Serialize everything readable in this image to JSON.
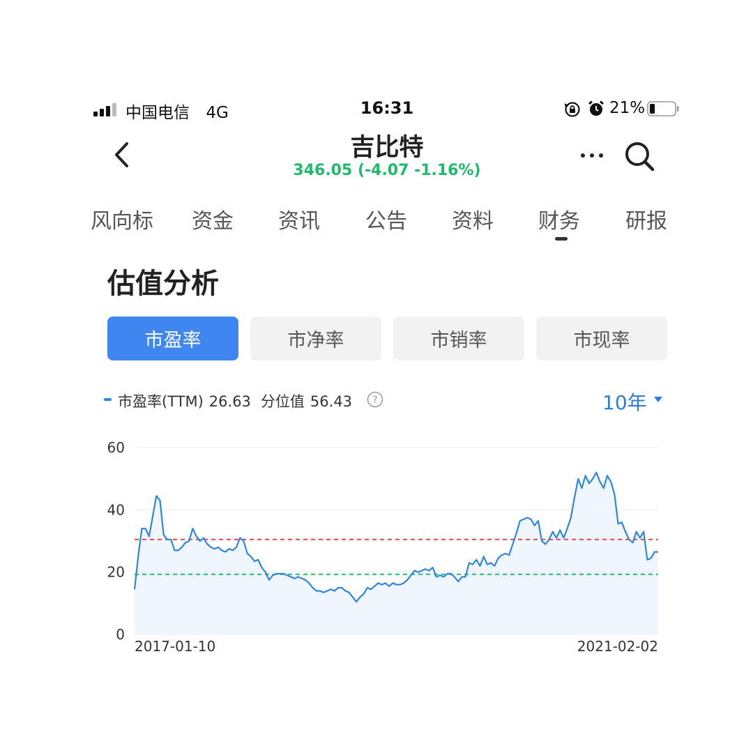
{
  "status_bar": {
    "carrier": "中国电信",
    "network": "4G",
    "time": "16:31",
    "battery_percent": "21%",
    "battery_level": 0.21
  },
  "header": {
    "title": "吉比特",
    "price_line": "346.05 (-4.07 -1.16%)",
    "price_color": "#1dbb6b"
  },
  "tabs": [
    {
      "label": "风向标"
    },
    {
      "label": "资金"
    },
    {
      "label": "资讯"
    },
    {
      "label": "公告"
    },
    {
      "label": "资料"
    },
    {
      "label": "财务",
      "active": true
    },
    {
      "label": "研报"
    }
  ],
  "section": {
    "title": "估值分析"
  },
  "segments": [
    {
      "label": "市盈率",
      "active": true
    },
    {
      "label": "市净率",
      "active": false
    },
    {
      "label": "市销率",
      "active": false
    },
    {
      "label": "市现率",
      "active": false
    }
  ],
  "legend": {
    "series_label": "市盈率(TTM)",
    "series_value": "26.63",
    "percentile_label": "分位值",
    "percentile_value": "56.43",
    "help_glyph": "?"
  },
  "period": {
    "label": "10年"
  },
  "colors": {
    "accent": "#3f86f0",
    "line": "#2e86e0",
    "upper_ref": "#e8434c",
    "lower_ref": "#1dbb6b"
  },
  "chart_data": {
    "type": "area",
    "x_start_label": "2017-01-10",
    "x_end_label": "2021-02-02",
    "ylim": [
      0,
      60
    ],
    "y_ticks": [
      "60",
      "40",
      "20",
      "0"
    ],
    "grid": true,
    "reference_lines": [
      {
        "value": 30.5,
        "color": "#e8434c",
        "style": "dashed"
      },
      {
        "value": 19.3,
        "color": "#1dbb6b",
        "style": "dashed"
      }
    ],
    "values": [
      14.5,
      25,
      34,
      34,
      31.5,
      38,
      44.5,
      43,
      32,
      30.5,
      30.5,
      27,
      27,
      28,
      29.5,
      30,
      34,
      31.5,
      30,
      31,
      29,
      28,
      27.5,
      28,
      27,
      26.5,
      27.5,
      27,
      28,
      31,
      30,
      26,
      25,
      23.5,
      24,
      21.5,
      20,
      17.5,
      19,
      19.5,
      19.5,
      19.5,
      19,
      18.5,
      18,
      18.5,
      18,
      17.5,
      16.5,
      15,
      14,
      14,
      13.5,
      14,
      14.5,
      14,
      15,
      15,
      14,
      13.5,
      12,
      10.5,
      12,
      13,
      15,
      14.5,
      15.5,
      16.5,
      16,
      16.5,
      15.5,
      16.5,
      16,
      16,
      16.5,
      17.5,
      19,
      20.5,
      20,
      20.5,
      21,
      20.5,
      21.5,
      18.5,
      19,
      18.5,
      19.5,
      19.5,
      18.5,
      17,
      18.5,
      18.5,
      23,
      22.5,
      24,
      22,
      25,
      22.5,
      23,
      22,
      24.5,
      25.5,
      26,
      25.5,
      29,
      32.5,
      36.5,
      37,
      37.5,
      37,
      35,
      36.5,
      30,
      29,
      30.5,
      33,
      31,
      33.5,
      31,
      34,
      37.5,
      44,
      50,
      47,
      51,
      48.5,
      50,
      52,
      49,
      47,
      51,
      49,
      45,
      35.5,
      36,
      33,
      30.5,
      29.5,
      33,
      31,
      33,
      24,
      24.5,
      26.5,
      26.5
    ]
  }
}
